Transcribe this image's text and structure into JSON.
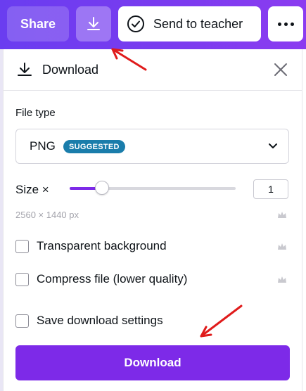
{
  "toolbar": {
    "share_label": "Share",
    "send_label": "Send to teacher",
    "icons": [
      "download-icon",
      "check-circle-icon",
      "more-icon"
    ]
  },
  "panel": {
    "title": "Download",
    "file_type_label": "File type",
    "file_type_value": "PNG",
    "badge": "SUGGESTED",
    "size_label": "Size ×",
    "size_value": "1",
    "size_slider_fraction": 0.2,
    "dimensions": "2560 × 1440 px",
    "options": [
      {
        "label": "Transparent background",
        "checked": false,
        "premium": true
      },
      {
        "label": "Compress file (lower quality)",
        "checked": false,
        "premium": true
      },
      {
        "label": "Save download settings",
        "checked": false,
        "premium": false
      }
    ],
    "download_button": "Download"
  },
  "colors": {
    "toolbar": "#7a3bef",
    "accent": "#7d2ae8",
    "badge": "#1a7dab",
    "annotation_arrow": "#e01b1b"
  }
}
